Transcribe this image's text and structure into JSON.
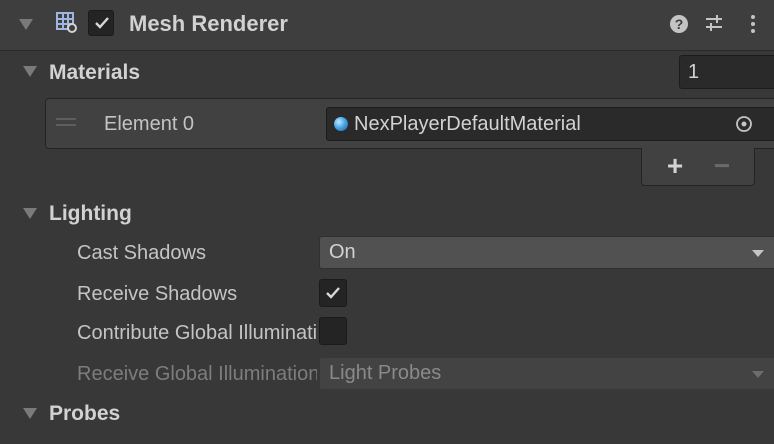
{
  "component": {
    "title": "Mesh Renderer",
    "enabled": true,
    "icon": "mesh-renderer-icon",
    "header_icons": [
      "help-icon",
      "presets-icon",
      "context-menu-icon"
    ]
  },
  "materials": {
    "label": "Materials",
    "count": "1",
    "elements": [
      {
        "label": "Element 0",
        "value": "NexPlayerDefaultMaterial"
      }
    ],
    "add_label": "+",
    "remove_label": "−"
  },
  "lighting": {
    "label": "Lighting",
    "cast_shadows": {
      "label": "Cast Shadows",
      "value": "On"
    },
    "receive_shadows": {
      "label": "Receive Shadows",
      "checked": true
    },
    "contribute_gi": {
      "label": "Contribute Global Illumination",
      "checked": false
    },
    "receive_gi": {
      "label": "Receive Global Illumination",
      "value": "Light Probes",
      "disabled": true
    }
  },
  "probes": {
    "label": "Probes"
  },
  "colors": {
    "background": "#383838",
    "header": "#3e3e3e",
    "field": "#2a2a2a",
    "dropdown": "#515151",
    "text": "#c4c4c4",
    "disabled_text": "#7d7d7d",
    "material_blue": "#4aa7e8"
  }
}
